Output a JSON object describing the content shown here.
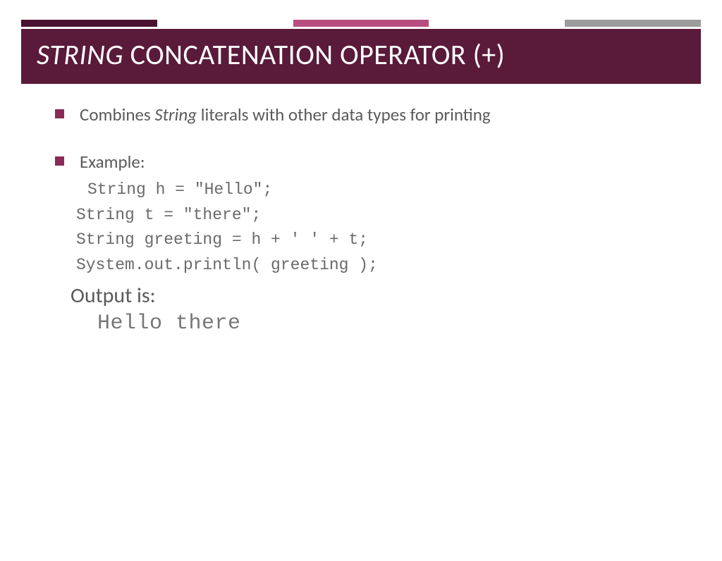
{
  "title": {
    "italic": "STRING",
    "rest": " CONCATENATION OPERATOR (+)"
  },
  "bullets": {
    "b1_pre": "Combines ",
    "b1_italic": "String",
    "b1_post": " literals with other data types for printing",
    "b2": "Example:"
  },
  "code": {
    "l1": "String h = \"Hello\";",
    "l2": "String t = \"there\";",
    "l3": "String greeting = h + ' ' + t;",
    "l4": "System.out.println( greeting );"
  },
  "output": {
    "label": "Output is:",
    "text": "Hello there"
  }
}
